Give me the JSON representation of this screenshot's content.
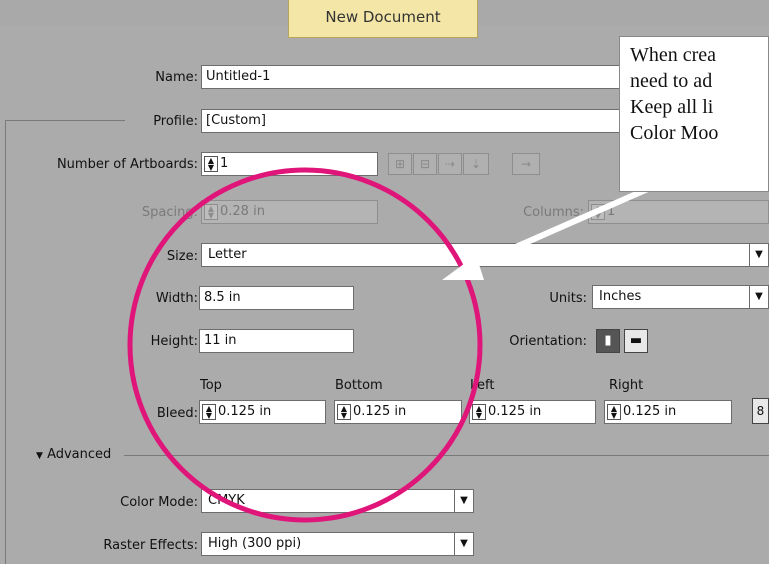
{
  "dialog": {
    "title": "New Document"
  },
  "name": {
    "label": "Name:",
    "value": "Untitled-1"
  },
  "profile": {
    "label": "Profile:",
    "value": "[Custom]"
  },
  "artboards": {
    "label": "Number of Artboards:",
    "value": "1",
    "arrow": "→"
  },
  "spacing": {
    "label": "Spacing:",
    "value": "0.28 in"
  },
  "columns": {
    "label": "Columns:",
    "value": "1"
  },
  "size": {
    "label": "Size:",
    "value": "Letter"
  },
  "width": {
    "label": "Width:",
    "value": "8.5 in"
  },
  "units": {
    "label": "Units:",
    "value": "Inches"
  },
  "height": {
    "label": "Height:",
    "value": "11 in"
  },
  "orientation": {
    "label": "Orientation:",
    "selected": "portrait"
  },
  "bleed": {
    "label": "Bleed:",
    "top_label": "Top",
    "bottom_label": "Bottom",
    "left_label": "Left",
    "right_label": "Right",
    "top": "0.125 in",
    "bottom": "0.125 in",
    "left": "0.125 in",
    "right": "0.125 in"
  },
  "advanced": {
    "label": "Advanced"
  },
  "color_mode": {
    "label": "Color Mode:",
    "value": "CMYK"
  },
  "raster_effects": {
    "label": "Raster Effects:",
    "value": "High (300 ppi)"
  },
  "callout": {
    "line1": "When crea",
    "line2": "need to ad",
    "line3": "Keep all li",
    "line4": "Color Moo"
  },
  "annotation_colors": {
    "circle": "#e0157a",
    "arrow": "#ffffff"
  }
}
